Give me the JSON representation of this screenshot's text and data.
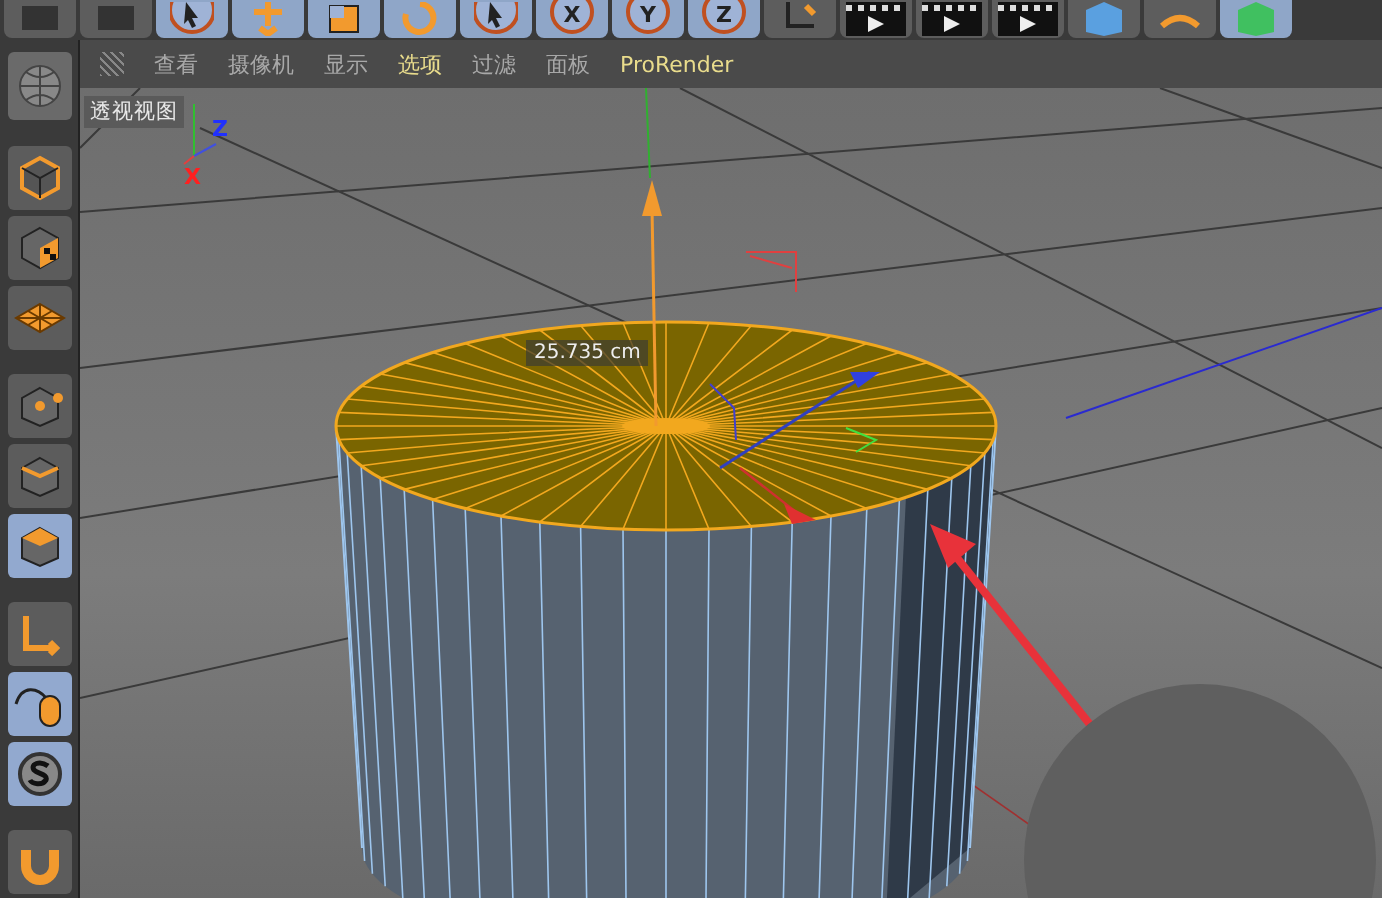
{
  "toolbar": [
    {
      "selected": false
    },
    {
      "selected": false
    },
    {
      "selected": true
    },
    {
      "selected": true
    },
    {
      "selected": true
    },
    {
      "selected": true
    },
    {
      "selected": true
    },
    {
      "selected": true,
      "label": "X"
    },
    {
      "selected": true,
      "label": "Y"
    },
    {
      "selected": true,
      "label": "Z"
    },
    {
      "selected": false
    },
    {
      "selected": false
    },
    {
      "selected": false
    },
    {
      "selected": false
    },
    {
      "selected": false
    },
    {
      "selected": false
    },
    {
      "selected": true
    }
  ],
  "view_menu": [
    {
      "label": "查看",
      "highlighted": false
    },
    {
      "label": "摄像机",
      "highlighted": false
    },
    {
      "label": "显示",
      "highlighted": false
    },
    {
      "label": "选项",
      "highlighted": true
    },
    {
      "label": "过滤",
      "highlighted": false
    },
    {
      "label": "面板",
      "highlighted": false
    },
    {
      "label": "ProRender",
      "highlighted": true
    }
  ],
  "left_tools": [
    {
      "selected": false
    },
    {
      "selected": false
    },
    {
      "selected": false
    },
    {
      "selected": false
    },
    {
      "selected": false
    },
    {
      "selected": true
    },
    {
      "selected": false
    },
    {
      "selected": true
    },
    {
      "selected": true
    },
    {
      "selected": false
    }
  ],
  "viewport": {
    "title": "透视视图",
    "axis_labels": [
      "Z",
      "X"
    ],
    "measurement": "25.735 cm"
  }
}
